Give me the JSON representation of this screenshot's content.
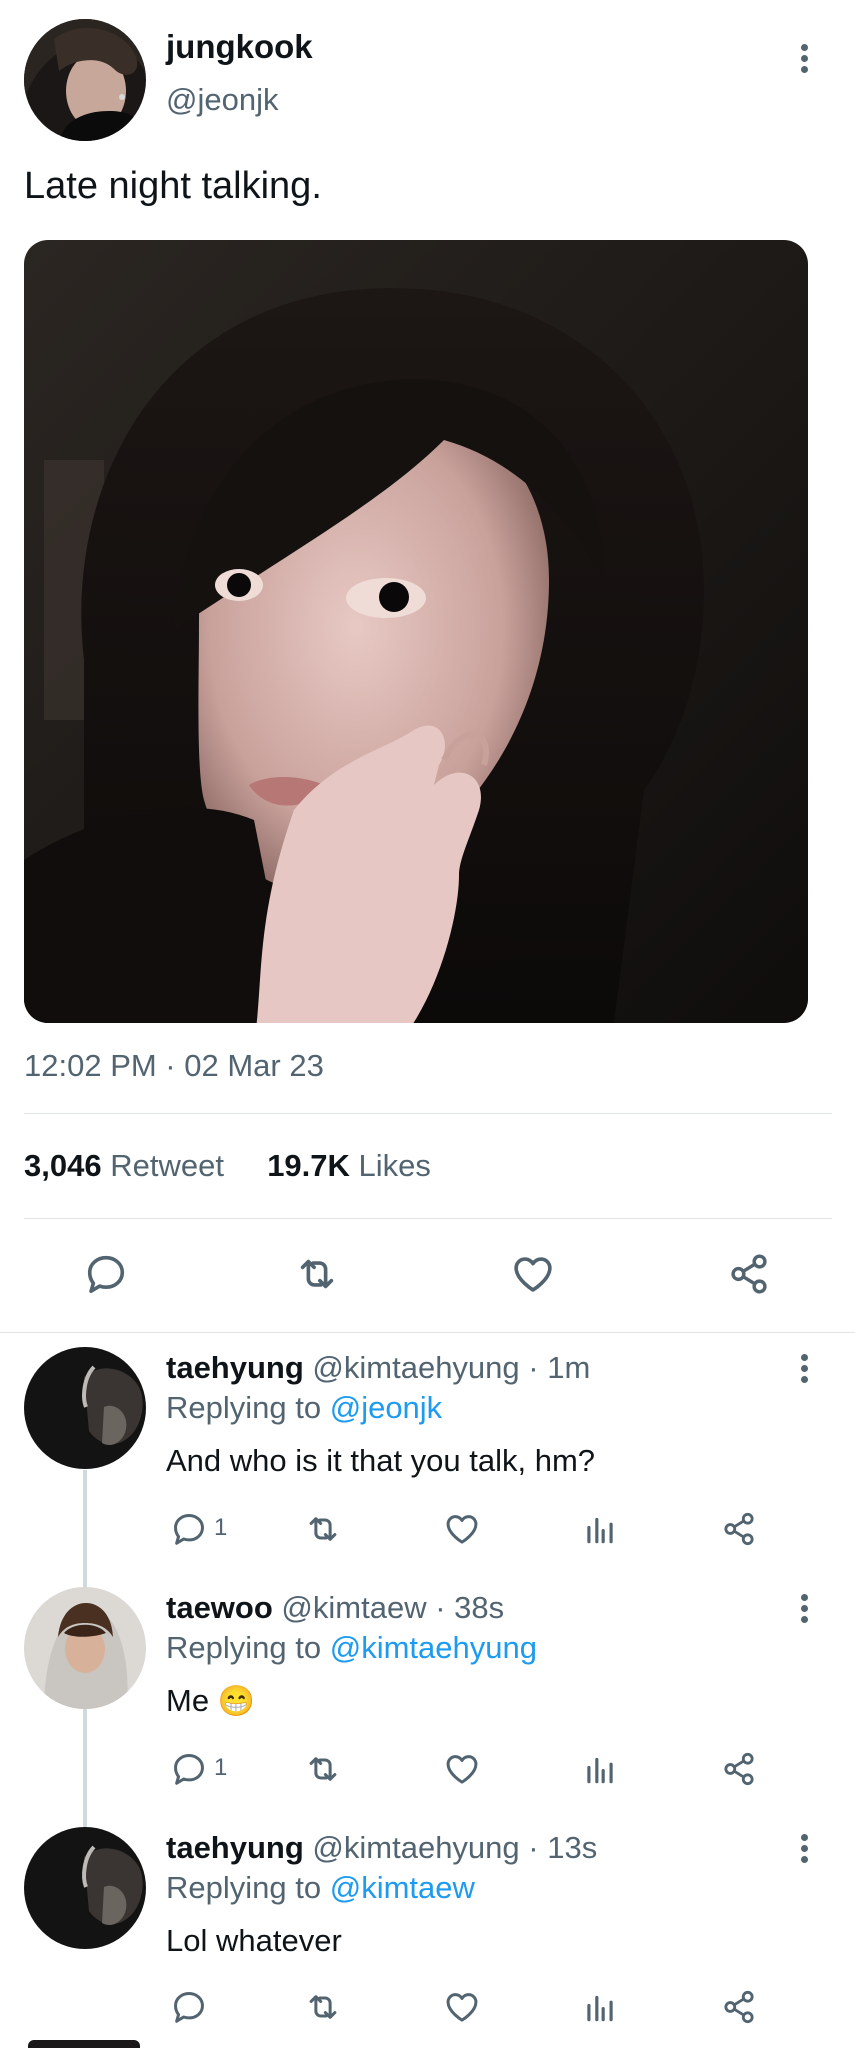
{
  "tweet": {
    "display_name": "jungkook",
    "handle": "@jeonjk",
    "text": "Late night talking.",
    "timestamp": "12:02 PM · 02 Mar 23",
    "retweet_count": "3,046",
    "retweet_label": "Retweet",
    "like_count": "19.7K",
    "like_label": "Likes"
  },
  "replies": [
    {
      "display_name": "taehyung",
      "handle": "@kimtaehyung",
      "time": "· 1m",
      "replying_prefix": "Replying to",
      "replying_to": "@jeonjk",
      "text": "And who is it that you talk, hm?",
      "reply_count": "1",
      "emoji": ""
    },
    {
      "display_name": "taewoo",
      "handle": "@kimtaew",
      "time": "· 38s",
      "replying_prefix": "Replying to",
      "replying_to": "@kimtaehyung",
      "text": "Me",
      "emoji": "😁",
      "reply_count": "1"
    },
    {
      "display_name": "taehyung",
      "handle": "@kimtaehyung",
      "time": "· 13s",
      "replying_prefix": "Replying to",
      "replying_to": "@kimtaew",
      "text": "Lol whatever",
      "emoji": "",
      "reply_count": ""
    }
  ],
  "colors": {
    "link": "#1d9bf0",
    "secondary_text": "#536471"
  },
  "icons": [
    "more-icon",
    "reply-icon",
    "retweet-icon",
    "like-icon",
    "share-icon",
    "analytics-icon"
  ]
}
